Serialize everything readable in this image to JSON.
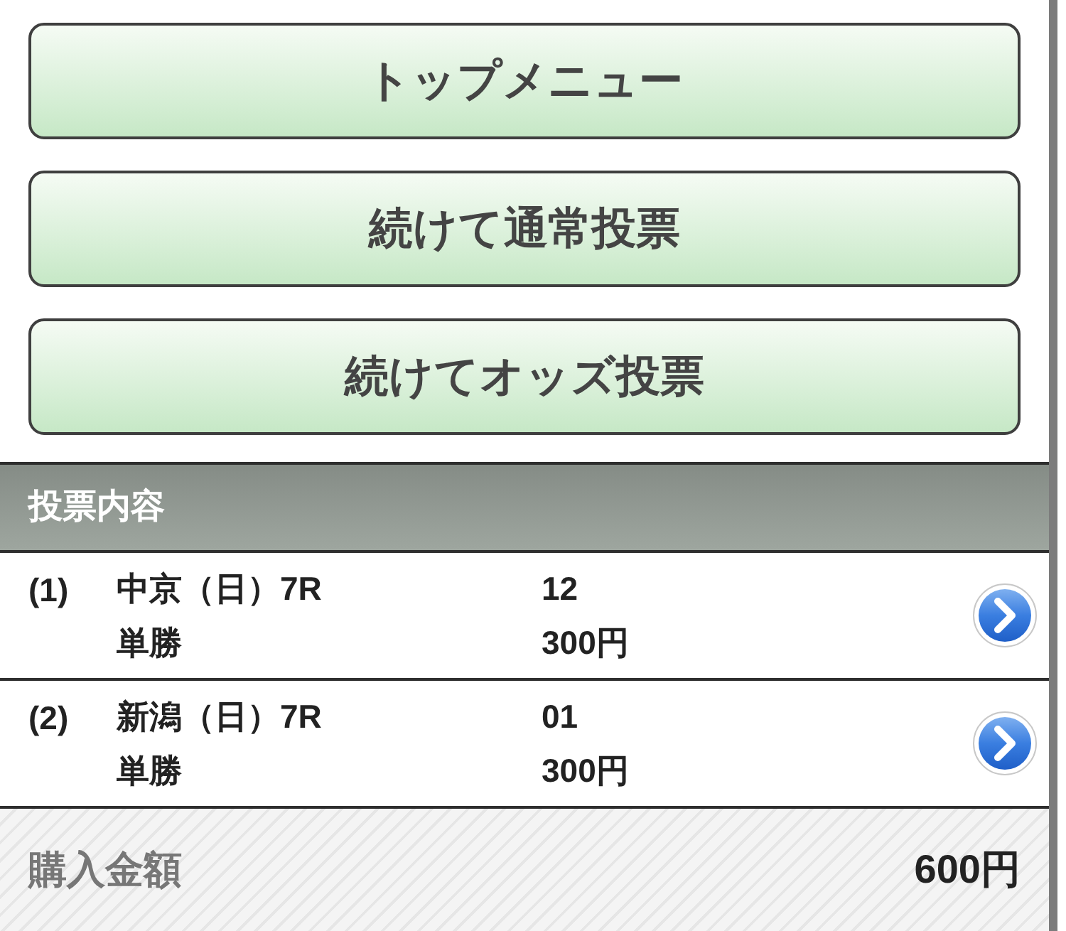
{
  "menu_buttons": [
    {
      "label": "トップメニュー"
    },
    {
      "label": "続けて通常投票"
    },
    {
      "label": "続けてオッズ投票"
    }
  ],
  "section": {
    "title": "投票内容"
  },
  "bets": [
    {
      "number": "(1)",
      "race": "中京（日）7R",
      "bet_type": "単勝",
      "selection": "12",
      "amount": "300円"
    },
    {
      "number": "(2)",
      "race": "新潟（日）7R",
      "bet_type": "単勝",
      "selection": "01",
      "amount": "300円"
    }
  ],
  "total": {
    "label": "購入金額",
    "amount": "600円"
  }
}
